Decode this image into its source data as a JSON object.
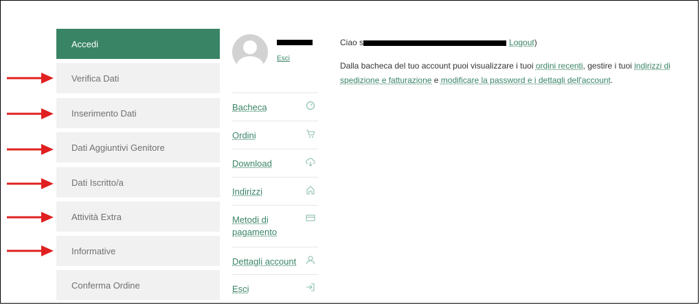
{
  "steps": [
    {
      "label": "Accedi",
      "active": true
    },
    {
      "label": "Verifica Dati",
      "active": false
    },
    {
      "label": "Inserimento Dati",
      "active": false
    },
    {
      "label": "Dati Aggiuntivi Genitore",
      "active": false
    },
    {
      "label": "Dati Iscritto/a",
      "active": false
    },
    {
      "label": "Attività Extra",
      "active": false
    },
    {
      "label": "Informative",
      "active": false
    },
    {
      "label": "Conferma Ordine",
      "active": false
    }
  ],
  "account_card": {
    "esci_label": "Esci"
  },
  "account_nav": [
    {
      "label": "Bacheca",
      "icon": "dashboard-icon"
    },
    {
      "label": "Ordini",
      "icon": "cart-icon"
    },
    {
      "label": "Download",
      "icon": "cloud-download-icon"
    },
    {
      "label": "Indirizzi",
      "icon": "home-icon"
    },
    {
      "label": "Metodi di pagamento",
      "icon": "credit-card-icon"
    },
    {
      "label": "Dettagli account",
      "icon": "user-icon"
    },
    {
      "label": "Esci",
      "icon": "logout-icon"
    }
  ],
  "main": {
    "greeting_prefix": "Ciao s",
    "greeting_logout": "Logout",
    "greeting_suffix": ")",
    "desc_1": "Dalla bacheca del tuo account puoi visualizzare i tuoi ",
    "link_orders": "ordini recenti",
    "desc_2": ", gestire i tuoi ",
    "link_addresses": "indirizzi di spedizione e fatturazione",
    "desc_3": " e ",
    "link_password": "modificare la password e i dettagli dell'account",
    "desc_4": "."
  },
  "colors": {
    "accent": "#3a8466",
    "step_bg": "#f1f1f1",
    "arrow": "#e02020"
  }
}
